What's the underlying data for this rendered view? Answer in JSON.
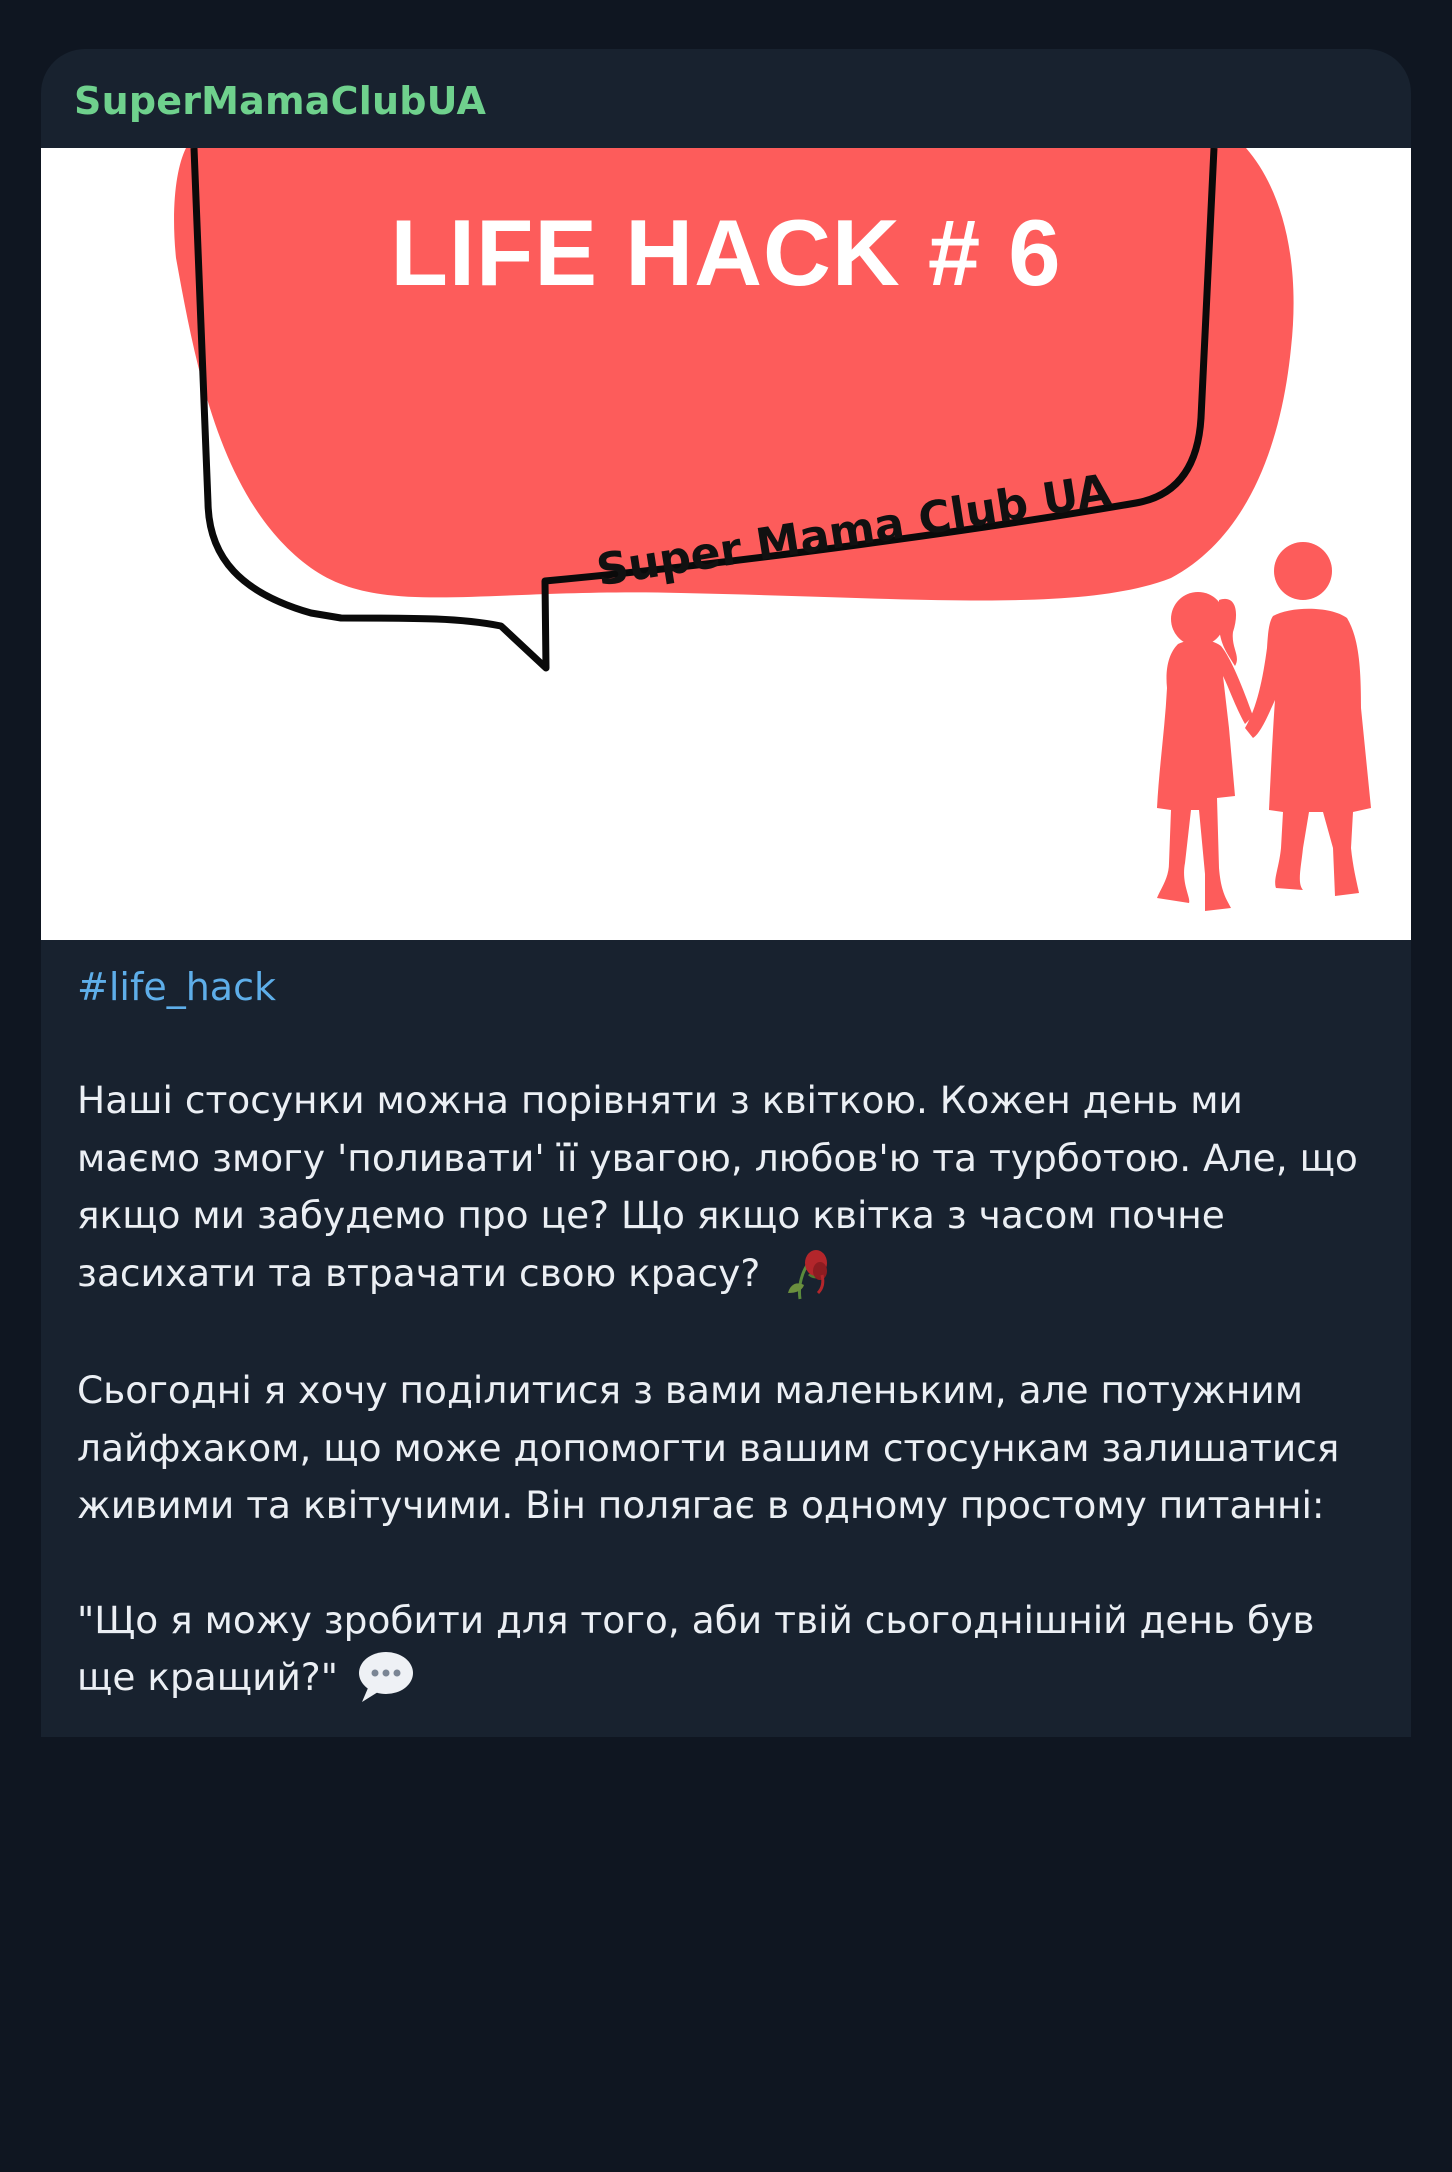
{
  "channel": {
    "name": "SuperMamaClubUA",
    "name_color": "#6fd18d"
  },
  "image": {
    "title": "LIFE HACK # 6",
    "subtitle": "Super Mama Club UA",
    "accent_color": "#fd5c5b"
  },
  "post": {
    "hashtag": "#life_hack",
    "paragraphs": [
      "Наші стосунки можна порівняти з квіткою. Кожен день ми маємо змогу 'поливати' її увагою, любов'ю та турботою. Але, що якщо ми забудемо про це? Що якщо квітка з часом почне засихати та втрачати свою красу?",
      "Сьогодні я хочу поділитися з вами маленьким, але потужним лайфхаком, що може допомогти вашим стосункам залишатися живими та квітучими. Він полягає в одному простому питанні:",
      "\"Що я можу зробити для того, аби твій сьогоднішній день був ще кращий?\""
    ],
    "emojis": [
      "wilted-flower-icon",
      "speech-balloon-icon"
    ]
  }
}
